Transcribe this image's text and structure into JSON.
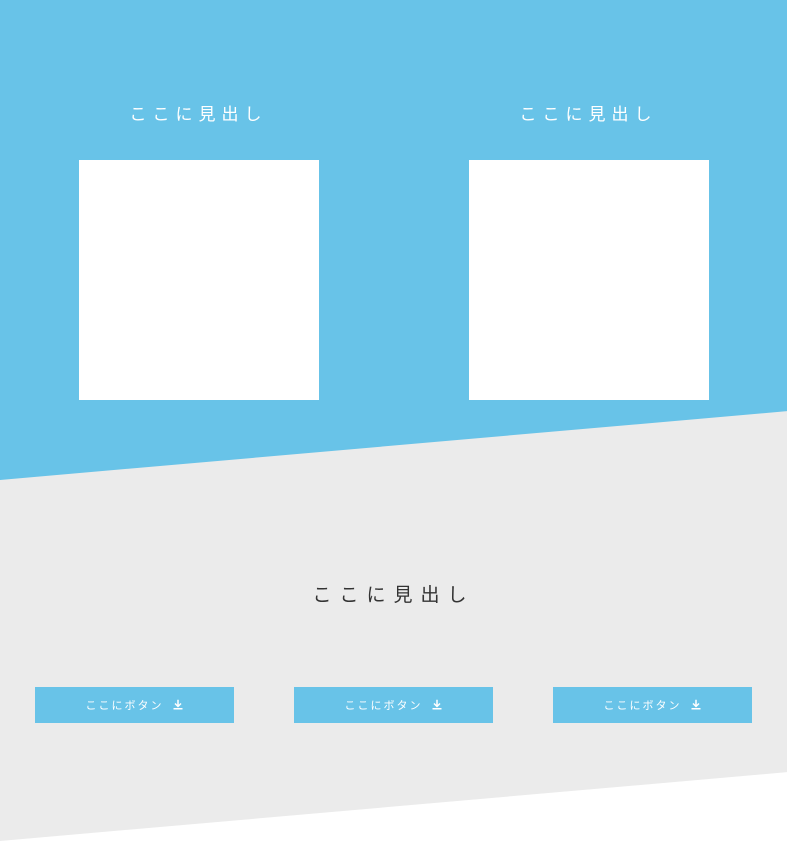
{
  "colors": {
    "blue": "#68c3e8",
    "grey": "#ebebeb",
    "white": "#ffffff",
    "text_dark": "#333333"
  },
  "hero": {
    "cards": [
      {
        "heading": "ここに見出し"
      },
      {
        "heading": "ここに見出し"
      }
    ]
  },
  "section": {
    "heading": "ここに見出し",
    "buttons": [
      {
        "label": "ここにボタン",
        "icon": "download-icon"
      },
      {
        "label": "ここにボタン",
        "icon": "download-icon"
      },
      {
        "label": "ここにボタン",
        "icon": "download-icon"
      }
    ]
  }
}
